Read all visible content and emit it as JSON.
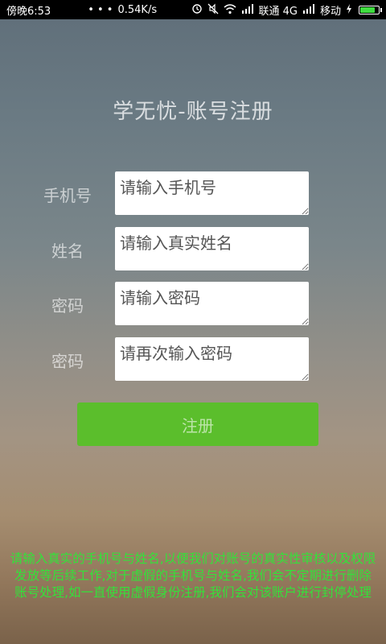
{
  "status_bar": {
    "time": "傍晚6:53",
    "dots": "• • •",
    "speed": "0.54K/s",
    "carrier1": "联通 4G",
    "carrier2": "移动"
  },
  "title": "学无忧-账号注册",
  "form": {
    "fields": [
      {
        "label": "手机号",
        "placeholder": "请输入手机号"
      },
      {
        "label": "姓名",
        "placeholder": "请输入真实姓名"
      },
      {
        "label": "密码",
        "placeholder": "请输入密码"
      },
      {
        "label": "密码",
        "placeholder": "请再次输入密码"
      }
    ],
    "submit_label": "注册"
  },
  "notice": "请输入真实的手机号与姓名,以便我们对账号的真实性审核以及权限发放等后续工作,对于虚假的手机号与姓名,我们会不定期进行删除账号处理,如一直使用虚假身份注册,我们会对该账户进行封停处理",
  "colors": {
    "accent": "#5bbe2c",
    "notice_text": "#34e13a",
    "battery": "#3fdc3f"
  },
  "battery_level": 0.9,
  "icons": [
    "alarm-icon",
    "mute-icon",
    "wifi-icon",
    "signal-icon",
    "signal-icon",
    "charging-icon",
    "battery-icon"
  ]
}
